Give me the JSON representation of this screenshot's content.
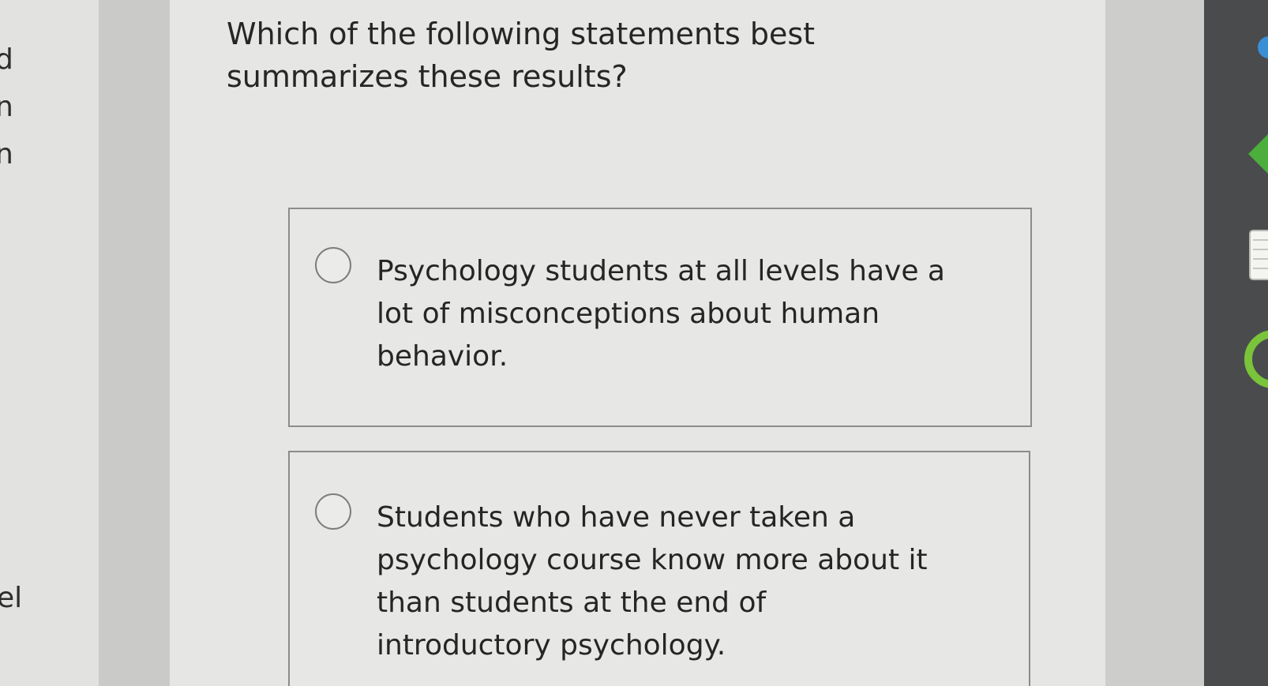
{
  "left_fragments": [
    {
      "text": "d"
    },
    {
      "text": "n"
    },
    {
      "text": "n"
    },
    {
      "text": "el"
    }
  ],
  "question": "Which of the following statements best summarizes these results?",
  "options": [
    {
      "text": "Psychology students at all levels have a lot of misconceptions about human behavior."
    },
    {
      "text": "Students who have never taken a psychology course know more about it than students at the end of introductory psychology."
    }
  ],
  "taskbar": {
    "icons": [
      "app-icon-blue",
      "app-icon-green",
      "notes-icon",
      "app-icon-green-ring"
    ],
    "colors": {
      "blue": "#3a8fd6",
      "green": "#4cae3c",
      "ring": "#79c43a"
    }
  }
}
